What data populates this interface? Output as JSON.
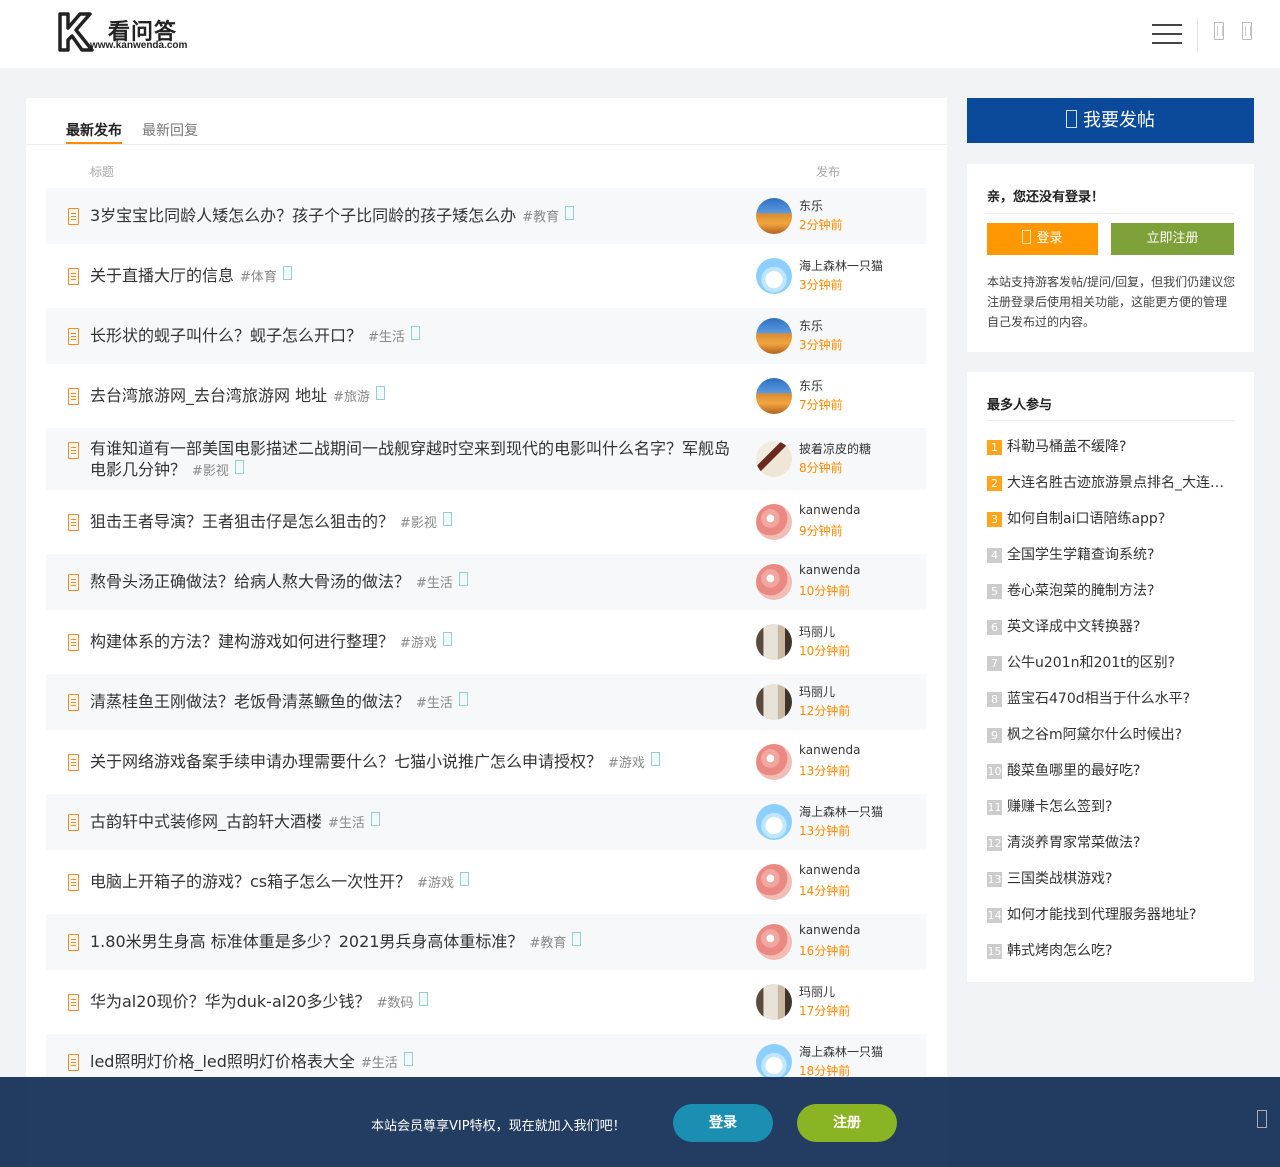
{
  "header": {
    "logo_name": "看问答",
    "logo_url": "www.kanwenda.com"
  },
  "tabs": [
    {
      "label": "最新发布"
    },
    {
      "label": "最新回复"
    }
  ],
  "columns": {
    "title": "标题",
    "post": "发布"
  },
  "rows": [
    {
      "title": "3岁宝宝比同龄人矮怎么办？孩子个子比同龄的孩子矮怎么办",
      "category": "#教育",
      "user": "东乐",
      "time": "2分钟前",
      "avatar": "desert"
    },
    {
      "title": "关于直播大厅的信息",
      "category": "#体育",
      "user": "海上森林一只猫",
      "time": "3分钟前",
      "avatar": "sea"
    },
    {
      "title": "长形状的蚬子叫什么？蚬子怎么开口？",
      "category": "#生活",
      "user": "东乐",
      "time": "3分钟前",
      "avatar": "desert"
    },
    {
      "title": "去台湾旅游网_去台湾旅游网 地址",
      "category": "#旅游",
      "user": "东乐",
      "time": "7分钟前",
      "avatar": "desert"
    },
    {
      "title": "有谁知道有一部美国电影描述二战期间一战舰穿越时空来到现代的电影叫什么名字？军舰岛电影几分钟？",
      "category": "#影视",
      "user": "披着凉皮的糖",
      "time": "8分钟前",
      "avatar": "book"
    },
    {
      "title": "狙击王者导演？王者狙击仔是怎么狙击的？",
      "category": "#影视",
      "user": "kanwenda",
      "time": "9分钟前",
      "avatar": "flower"
    },
    {
      "title": "熬骨头汤正确做法？给病人熬大骨汤的做法？",
      "category": "#生活",
      "user": "kanwenda",
      "time": "10分钟前",
      "avatar": "flower"
    },
    {
      "title": "构建体系的方法？建构游戏如何进行整理？",
      "category": "#游戏",
      "user": "玛丽儿",
      "time": "10分钟前",
      "avatar": "room"
    },
    {
      "title": "清蒸桂鱼王刚做法？老饭骨清蒸鳜鱼的做法？",
      "category": "#生活",
      "user": "玛丽儿",
      "time": "12分钟前",
      "avatar": "room"
    },
    {
      "title": "关于网络游戏备案手续申请办理需要什么？七猫小说推广怎么申请授权？",
      "category": "#游戏",
      "user": "kanwenda",
      "time": "13分钟前",
      "avatar": "flower"
    },
    {
      "title": "古韵轩中式装修网_古韵轩大酒楼",
      "category": "#生活",
      "user": "海上森林一只猫",
      "time": "13分钟前",
      "avatar": "sea"
    },
    {
      "title": "电脑上开箱子的游戏？cs箱子怎么一次性开？",
      "category": "#游戏",
      "user": "kanwenda",
      "time": "14分钟前",
      "avatar": "flower"
    },
    {
      "title": "1.80米男生身高 标准体重是多少？2021男兵身高体重标准？",
      "category": "#教育",
      "user": "kanwenda",
      "time": "16分钟前",
      "avatar": "flower"
    },
    {
      "title": "华为al20现价？华为duk-al20多少钱？",
      "category": "#数码",
      "user": "玛丽儿",
      "time": "17分钟前",
      "avatar": "room"
    },
    {
      "title": "led照明灯价格_led照明灯价格表大全",
      "category": "#生活",
      "user": "海上森林一只猫",
      "time": "18分钟前",
      "avatar": "sea"
    }
  ],
  "sidebar": {
    "post_button": "我要发帖",
    "login_greeting": "亲，您还没有登录！",
    "login_button": "登录",
    "register_button": "立即注册",
    "login_note": "本站支持游客发帖/提问/回复，但我们仍建议您注册登录后使用相关功能，这能更方便的管理自己发布过的内容。",
    "hot_title": "最多人参与",
    "hot_items": [
      "科勒马桶盖不缓降?",
      "大连名胜古迹旅游景点排名_大连名胜古迹旅游景点排名图片",
      "如何自制ai口语陪练app?",
      "全国学生学籍查询系统?",
      "卷心菜泡菜的腌制方法?",
      "英文译成中文转换器?",
      "公牛u201n和201t的区别?",
      "蓝宝石470d相当于什么水平?",
      "枫之谷m阿黛尔什么时候出?",
      "酸菜鱼哪里的最好吃?",
      "赚赚卡怎么签到?",
      "清淡养胃家常菜做法?",
      "三国类战棋游戏?",
      "如何才能找到代理服务器地址?",
      "韩式烤肉怎么吃?"
    ]
  },
  "bottom_bar": {
    "message": "本站会员尊享VIP特权，现在就加入我们吧！",
    "login": "登录",
    "register": "注册"
  },
  "colors": {
    "accent": "#ff8a00",
    "brand_blue": "#0b4a9a",
    "register_green": "#7ea13a"
  }
}
